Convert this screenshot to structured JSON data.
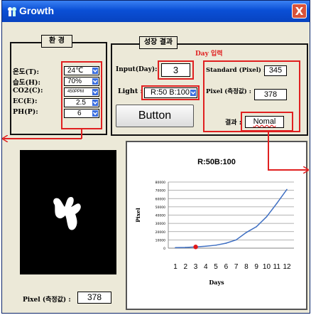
{
  "window": {
    "title": "Growth",
    "close_glyph": "X"
  },
  "environment": {
    "legend": "환 경",
    "labels": [
      "온도(T):",
      "습도(H):",
      "CO2(C):",
      "EC(E):",
      "PH(P):"
    ],
    "values": [
      "24℃",
      "70%",
      "450PPM",
      "2.5",
      "6"
    ]
  },
  "growth_result": {
    "legend": "성장 결과",
    "input_label": "Input(Day):",
    "input_value": "3",
    "annotation": "Day 입력",
    "light_label": "Light :",
    "light_value": "R:50 B:100",
    "button_label": "Button",
    "standard_label": "Standard (Pixel) :",
    "standard_value": "345",
    "pixel_label": "Pixel (측정값) :",
    "pixel_value": "378",
    "result_label": "결과 :",
    "result_value": "Nomal"
  },
  "bottom_pixel": {
    "label": "Pixel (측정값) :",
    "value": "378"
  },
  "chart_data": {
    "type": "line",
    "title": "R:50B:100",
    "xlabel": "Days",
    "ylabel": "Pixel",
    "ylim": [
      0,
      80000
    ],
    "yticks": [
      0,
      10000,
      20000,
      30000,
      40000,
      50000,
      60000,
      70000,
      80000
    ],
    "x": [
      1,
      2,
      3,
      4,
      5,
      6,
      7,
      8,
      9,
      10,
      11,
      12
    ],
    "series": [
      {
        "values": [
          600,
          900,
          1500,
          2400,
          3600,
          6000,
          10000,
          19000,
          26000,
          38000,
          54000,
          71000
        ],
        "color": "#3f6fc2"
      }
    ],
    "highlight": {
      "x": 3,
      "y": 1500,
      "color": "#e01818"
    },
    "grid": true
  },
  "colors": {
    "accent": "#e02020",
    "title_bar": "#0a4fd6",
    "line": "#3f6fc2"
  }
}
